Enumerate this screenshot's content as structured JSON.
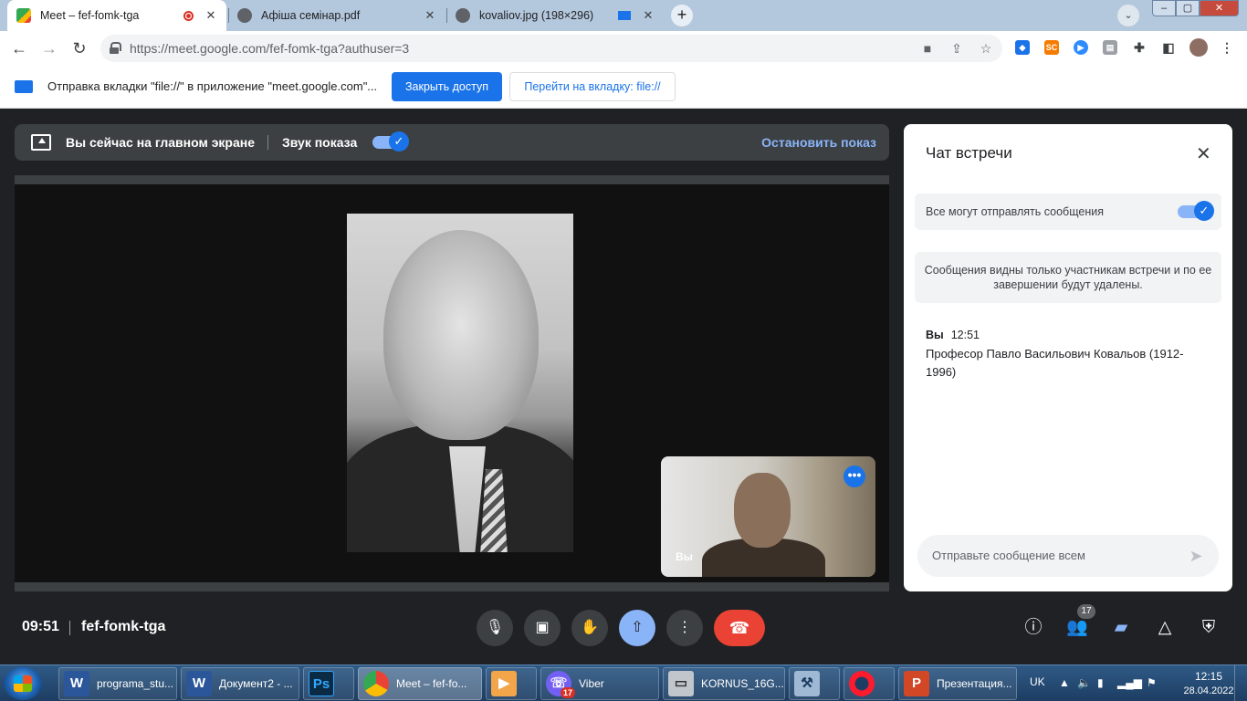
{
  "browser": {
    "tabs": [
      {
        "title": "Meet – fef-fomk-tga",
        "favicon": "google-meet-icon",
        "active": true,
        "recording": true
      },
      {
        "title": "Афіша семінар.pdf",
        "favicon": "globe-icon",
        "active": false
      },
      {
        "title": "kovaliov.jpg (198×296)",
        "favicon": "globe-icon",
        "active": false,
        "casting": true
      }
    ],
    "new_tab": "+",
    "url": "https://meet.google.com/fef-fomk-tga?authuser=3"
  },
  "infobar": {
    "message": "Отправка вкладки \"file://\" в приложение \"meet.google.com\"...",
    "stop_sharing_label": "Закрыть доступ",
    "switch_tab_label": "Перейти на вкладку: file://"
  },
  "presenting_bar": {
    "text": "Вы сейчас на главном экране",
    "audio_label": "Звук показа",
    "audio_on": true,
    "stop_label": "Остановить показ"
  },
  "self_view": {
    "label": "Вы"
  },
  "chat": {
    "title": "Чат встречи",
    "permission_label": "Все могут отправлять сообщения",
    "permission_on": true,
    "notice": "Сообщения видны только участникам встречи и по ее завершении будут удалены.",
    "messages": [
      {
        "sender": "Вы",
        "time": "12:51",
        "text": "Професор Павло Васильович Ковальов (1912-1996)"
      }
    ],
    "input_placeholder": "Отправьте сообщение всем"
  },
  "call_bar": {
    "time": "09:51",
    "meeting_code": "fef-fomk-tga",
    "participants_count": "17"
  },
  "taskbar": {
    "items": [
      {
        "label": "programa_stu...",
        "icon": "word-icon"
      },
      {
        "label": "Документ2 - ...",
        "icon": "word-icon"
      },
      {
        "label": "",
        "icon": "photoshop-icon"
      },
      {
        "label": "Meet – fef-fo...",
        "icon": "chrome-icon",
        "active": true
      },
      {
        "label": "",
        "icon": "media-player-icon"
      },
      {
        "label": "Viber",
        "icon": "viber-icon",
        "badge": "17"
      },
      {
        "label": "KORNUS_16G...",
        "icon": "drive-icon"
      },
      {
        "label": "",
        "icon": "tool-icon"
      },
      {
        "label": "",
        "icon": "opera-icon"
      },
      {
        "label": "Презентация...",
        "icon": "powerpoint-icon"
      }
    ],
    "language": "UK",
    "time": "12:15",
    "date": "28.04.2022"
  }
}
